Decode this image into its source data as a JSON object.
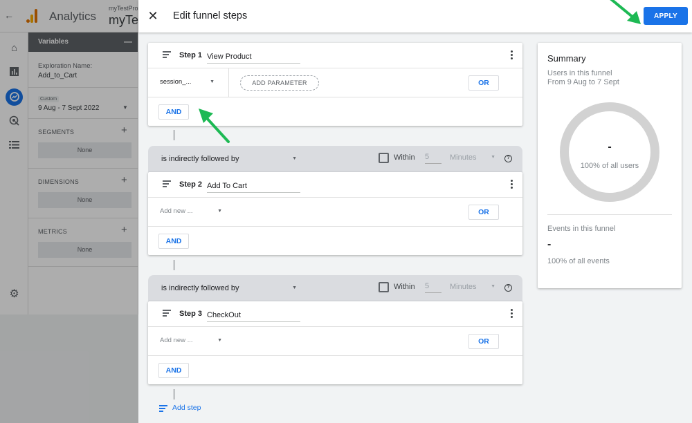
{
  "background": {
    "app_name": "Analytics",
    "property_small": "myTestProperty",
    "property_big": "myTestProperty",
    "variables_panel": {
      "title": "Variables",
      "exploration_name_label": "Exploration Name:",
      "exploration_name_value": "Add_to_Cart",
      "date_chip": "Custom",
      "date_range": "9 Aug - 7 Sept 2022",
      "segments_label": "SEGMENTS",
      "segments_value": "None",
      "dimensions_label": "DIMENSIONS",
      "dimensions_value": "None",
      "metrics_label": "METRICS",
      "metrics_value": "None"
    }
  },
  "editor": {
    "title": "Edit funnel steps",
    "apply_label": "APPLY",
    "or_label": "OR",
    "and_label": "AND",
    "add_parameter_label": "ADD PARAMETER",
    "add_step_label": "Add step",
    "steps": [
      {
        "label": "Step 1",
        "name": "View Product",
        "event": "session_..."
      },
      {
        "label": "Step 2",
        "name": "Add To Cart",
        "event": "Add new ..."
      },
      {
        "label": "Step 3",
        "name": "CheckOut",
        "event": "Add new ..."
      }
    ],
    "transitions": [
      {
        "relation": "is indirectly followed by",
        "within_label": "Within",
        "within_value": "5",
        "unit": "Minutes"
      },
      {
        "relation": "is indirectly followed by",
        "within_label": "Within",
        "within_value": "5",
        "unit": "Minutes"
      }
    ]
  },
  "summary": {
    "title": "Summary",
    "users_label": "Users in this funnel",
    "date_range": "From 9 Aug to 7 Sept",
    "users_value": "-",
    "users_pct": "100% of all users",
    "events_label": "Events in this funnel",
    "events_value": "-",
    "events_pct": "100% of all events"
  },
  "icons": {
    "annotation_arrow_color": "#1db954",
    "accent": "#1a73e8"
  }
}
